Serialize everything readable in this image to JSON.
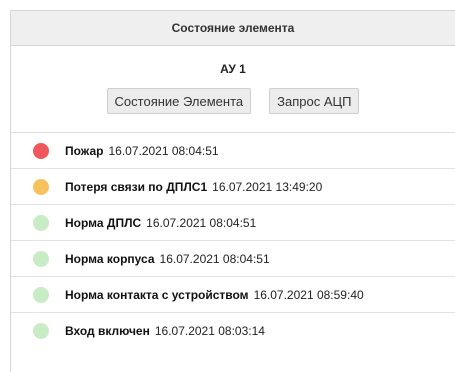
{
  "panel": {
    "title": "Состояние элемента"
  },
  "device": {
    "name": "АУ 1"
  },
  "buttons": {
    "element_state": "Состояние Элемента",
    "adc_request": "Запрос АЦП"
  },
  "events": [
    {
      "name": "Пожар",
      "time": "16.07.2021 08:04:51",
      "status": "fire",
      "color": "#f0575c"
    },
    {
      "name": "Потеря связи по ДПЛС1",
      "time": "16.07.2021 13:49:20",
      "status": "warning",
      "color": "#f7c25e"
    },
    {
      "name": "Норма ДПЛС",
      "time": "16.07.2021 08:04:51",
      "status": "normal",
      "color": "#c8ecc6"
    },
    {
      "name": "Норма корпуса",
      "time": "16.07.2021 08:04:51",
      "status": "normal",
      "color": "#c8ecc6"
    },
    {
      "name": "Норма контакта с устройством",
      "time": "16.07.2021 08:59:40",
      "status": "normal",
      "color": "#c8ecc6"
    },
    {
      "name": "Вход включен",
      "time": "16.07.2021 08:03:14",
      "status": "normal",
      "color": "#c8ecc6"
    }
  ]
}
